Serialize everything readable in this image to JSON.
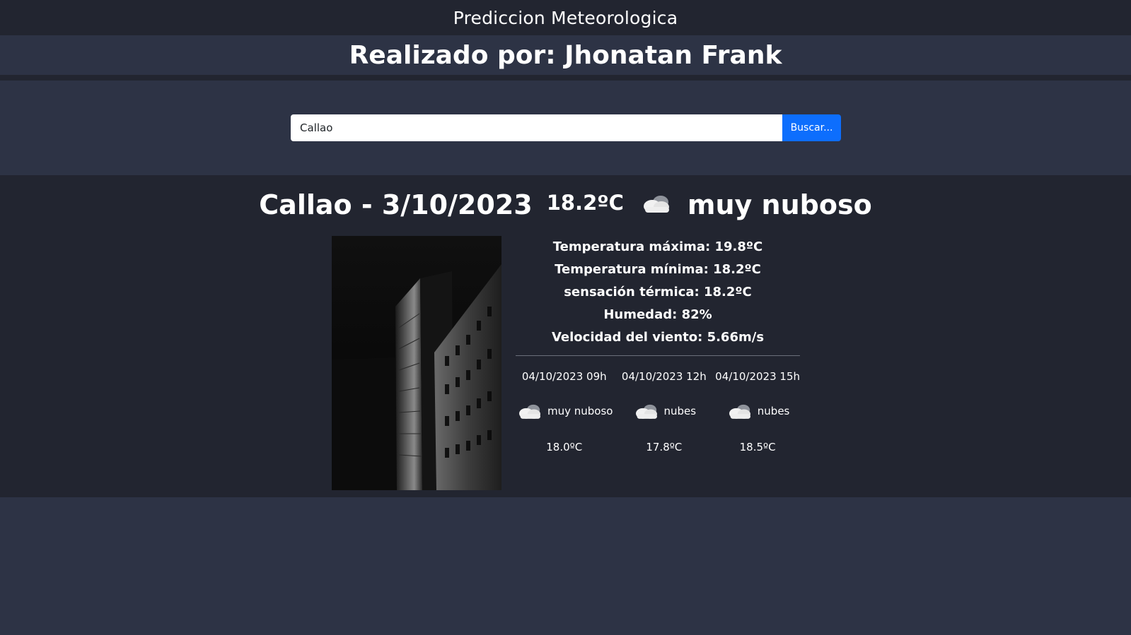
{
  "header": {
    "title": "Prediccion Meteorologica",
    "author": "Realizado por: Jhonatan Frank"
  },
  "search": {
    "value": "Callao",
    "button_label": "Buscar..."
  },
  "current": {
    "city_date": "Callao - 3/10/2023",
    "temperature": "18.2ºC",
    "icon": "cloud-icon",
    "description": "muy nuboso"
  },
  "details": {
    "max_temp": "Temperatura máxima: 19.8ºC",
    "min_temp": "Temperatura mínima: 18.2ºC",
    "feels_like": "sensación térmica: 18.2ºC",
    "humidity": "Humedad: 82%",
    "wind": "Velocidad del viento: 5.66m/s"
  },
  "forecast": [
    {
      "datetime": "04/10/2023 09h",
      "icon": "cloud-icon",
      "description": "muy nuboso",
      "temperature": "18.0ºC"
    },
    {
      "datetime": "04/10/2023 12h",
      "icon": "cloud-icon",
      "description": "nubes",
      "temperature": "17.8ºC"
    },
    {
      "datetime": "04/10/2023 15h",
      "icon": "cloud-icon",
      "description": "nubes",
      "temperature": "18.5ºC"
    }
  ]
}
